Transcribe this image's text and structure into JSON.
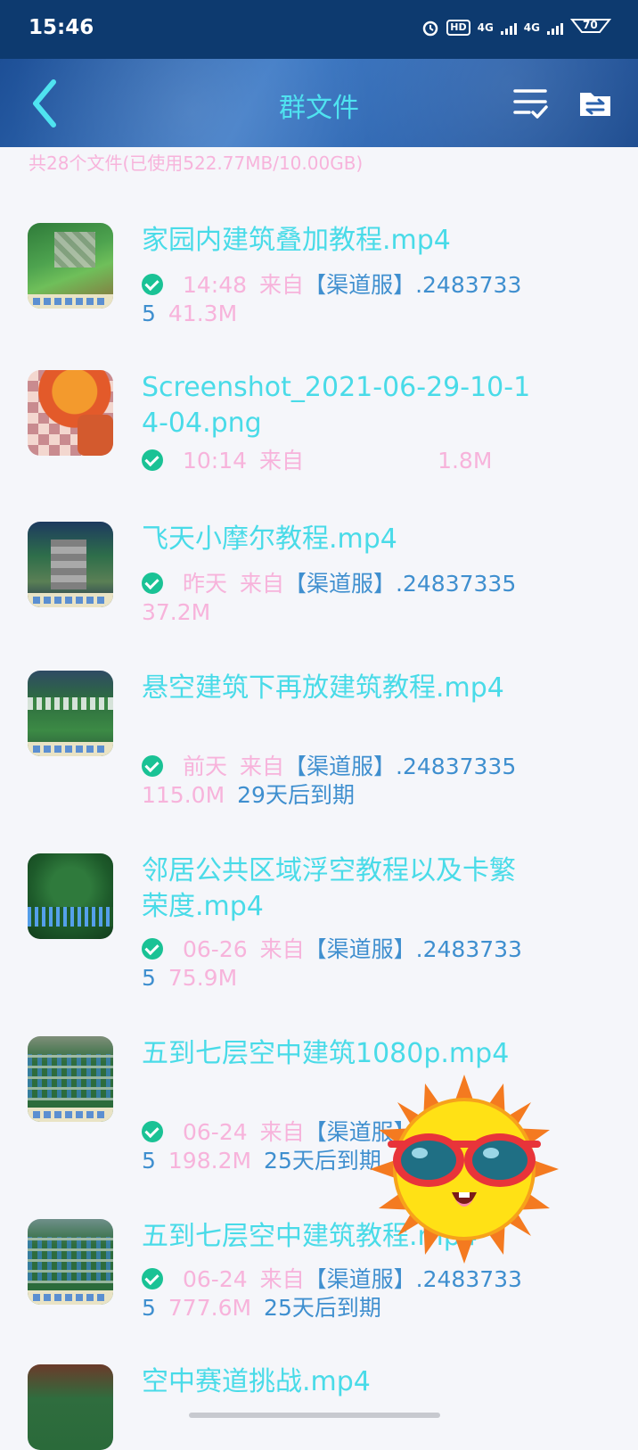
{
  "status": {
    "time": "15:46",
    "hd": "HD",
    "net1": "4G",
    "net2": "4G",
    "battery": "70"
  },
  "header": {
    "title": "群文件"
  },
  "summary": "共28个文件(已使用522.77MB/10.00GB)",
  "files": [
    {
      "name": "家园内建筑叠加教程.mp4",
      "time": "14:48",
      "from_label": "来自",
      "sender": "【渠道服】.24837335",
      "size": "41.3M",
      "expire": ""
    },
    {
      "name": "Screenshot_2021-06-29-10-14-04.png",
      "time": "10:14",
      "from_label": "来自",
      "sender": "",
      "size": "1.8M",
      "expire": ""
    },
    {
      "name": "飞天小摩尔教程.mp4",
      "time": "昨天",
      "from_label": "来自",
      "sender": "【渠道服】.24837335",
      "size": "37.2M",
      "expire": ""
    },
    {
      "name": "悬空建筑下再放建筑教程.mp4",
      "time": "前天",
      "from_label": "来自",
      "sender": "【渠道服】.24837335",
      "size": "115.0M",
      "expire": "29天后到期"
    },
    {
      "name": "邻居公共区域浮空教程以及卡繁荣度.mp4",
      "time": "06-26",
      "from_label": "来自",
      "sender": "【渠道服】.24837335",
      "size": "75.9M",
      "expire": ""
    },
    {
      "name": "五到七层空中建筑1080p.mp4",
      "time": "06-24",
      "from_label": "来自",
      "sender": "【渠道服】.24837335",
      "size": "198.2M",
      "expire": "25天后到期"
    },
    {
      "name": "五到七层空中建筑教程.mp4",
      "time": "06-24",
      "from_label": "来自",
      "sender": "【渠道服】.24837335",
      "size": "777.6M",
      "expire": "25天后到期"
    },
    {
      "name": "空中赛道挑战.mp4",
      "time": "",
      "from_label": "",
      "sender": "",
      "size": "",
      "expire": ""
    }
  ],
  "colors": {
    "accent": "#49dbe8",
    "pink": "#f7b3db",
    "blue": "#3f8fcf",
    "check": "#1ac295"
  },
  "icons": {
    "back": "back-arrow-icon",
    "select": "multi-select-icon",
    "transfer": "file-transfer-icon",
    "sticker": "sun-sunglasses-sticker"
  }
}
